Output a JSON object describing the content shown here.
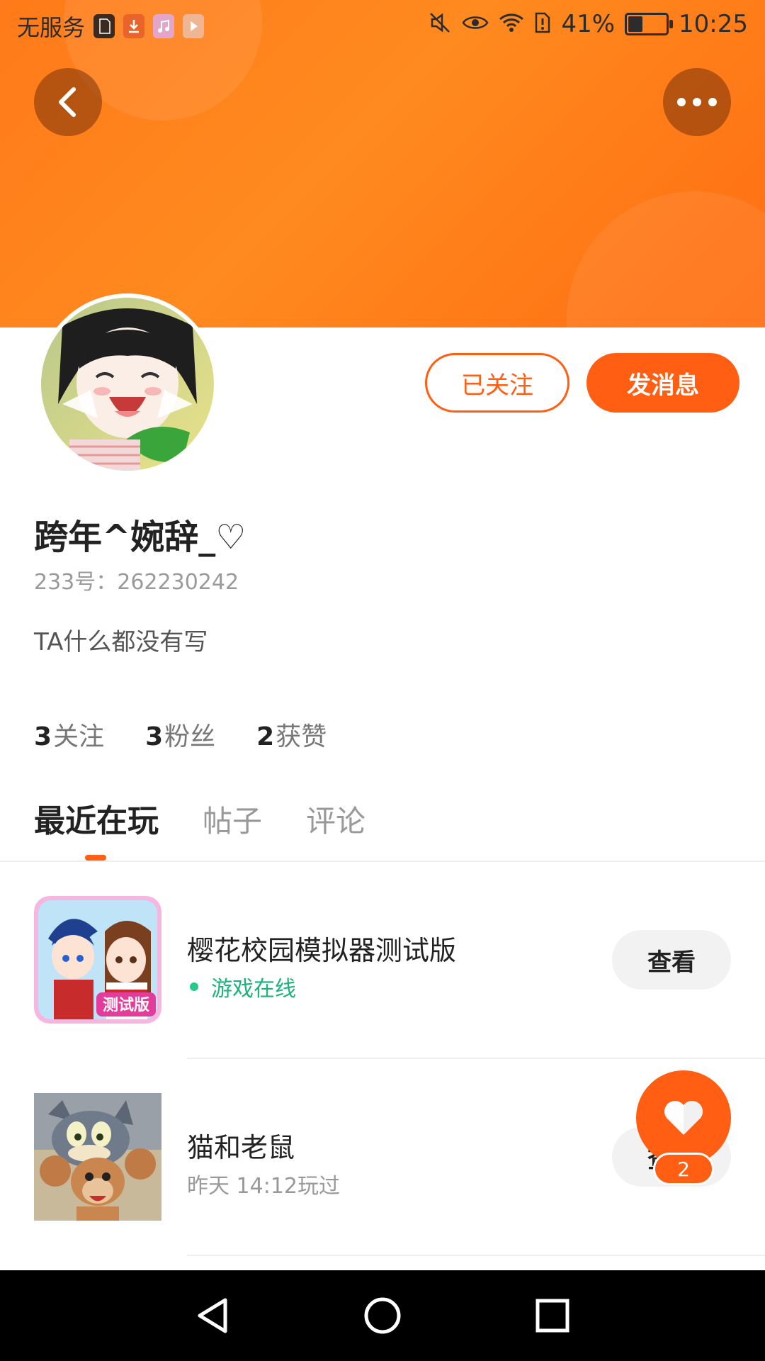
{
  "status_bar": {
    "carrier": "无服务",
    "battery": "41%",
    "battery_level": 0.41,
    "time": "10:25",
    "icons": [
      "sd-card-icon",
      "download-icon",
      "music-icon",
      "video-icon",
      "mute-icon",
      "eye-icon",
      "wifi-icon",
      "sim-alert-icon",
      "battery-icon"
    ]
  },
  "header": {
    "back_icon": "back-arrow-icon",
    "more_icon": "more-dots-icon",
    "gradient_colors": [
      "#ff7a1a",
      "#ff6d12"
    ]
  },
  "profile": {
    "username": "跨年^婉辞_♡",
    "user_id": "233号：262230242",
    "bio": "TA什么都没有写",
    "follow_button": "已关注",
    "message_button": "发消息",
    "stats": [
      {
        "value": "3",
        "label": "关注"
      },
      {
        "value": "3",
        "label": "粉丝"
      },
      {
        "value": "2",
        "label": "获赞"
      }
    ]
  },
  "tabs": [
    {
      "label": "最近在玩",
      "active": true
    },
    {
      "label": "帖子",
      "active": false
    },
    {
      "label": "评论",
      "active": false
    }
  ],
  "games": [
    {
      "name": "樱花校园模拟器测试版",
      "status": "游戏在线",
      "button": "查看",
      "icon_badge": "测试版"
    },
    {
      "name": "猫和老鼠",
      "status": "昨天 14:12玩过",
      "button": "查看"
    }
  ],
  "fab": {
    "icon": "heart-icon",
    "count": "2"
  },
  "nav": {
    "icons": [
      "nav-back-icon",
      "nav-home-icon",
      "nav-recent-icon"
    ]
  },
  "colors": {
    "accent": "#ff5e13",
    "online": "#1bb37b"
  }
}
